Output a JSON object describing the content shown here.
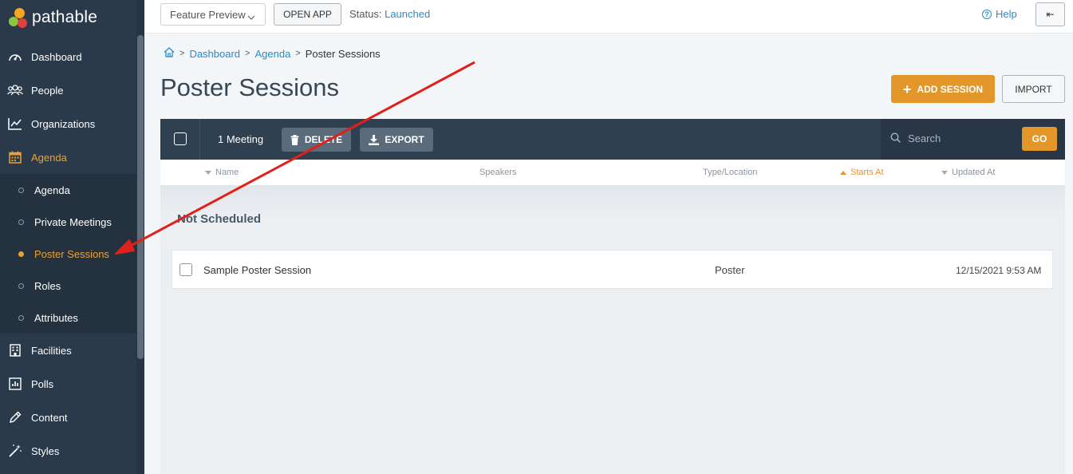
{
  "brand": {
    "name": "pathable"
  },
  "sidebar": {
    "items": [
      {
        "label": "Dashboard",
        "icon": "gauge-icon"
      },
      {
        "label": "People",
        "icon": "people-icon"
      },
      {
        "label": "Organizations",
        "icon": "chart-line-icon"
      },
      {
        "label": "Agenda",
        "icon": "calendar-icon",
        "active": true
      },
      {
        "label": "Facilities",
        "icon": "building-icon"
      },
      {
        "label": "Polls",
        "icon": "bar-chart-icon"
      },
      {
        "label": "Content",
        "icon": "pencil-icon"
      },
      {
        "label": "Styles",
        "icon": "magic-wand-icon"
      }
    ],
    "agenda_sub": [
      {
        "label": "Agenda"
      },
      {
        "label": "Private Meetings"
      },
      {
        "label": "Poster Sessions",
        "active": true
      },
      {
        "label": "Roles"
      },
      {
        "label": "Attributes"
      }
    ]
  },
  "topbar": {
    "feature_preview": "Feature Preview",
    "open_app": "OPEN APP",
    "status_label": "Status:",
    "status_value": "Launched",
    "help": "Help",
    "collapse": "⇤"
  },
  "breadcrumb": {
    "items": [
      "Dashboard",
      "Agenda",
      "Poster Sessions"
    ]
  },
  "page": {
    "title": "Poster Sessions",
    "add_session": "ADD SESSION",
    "import": "IMPORT"
  },
  "toolbar": {
    "count": "1 Meeting",
    "delete": "DELETE",
    "export": "EXPORT",
    "search_placeholder": "Search",
    "go": "GO"
  },
  "table": {
    "columns": [
      "Name",
      "Speakers",
      "Type/Location",
      "Starts At",
      "Updated At"
    ],
    "groups": [
      {
        "title": "Not Scheduled",
        "rows": [
          {
            "name": "Sample Poster Session",
            "speakers": "",
            "type": "Poster",
            "starts_at": "",
            "updated_at": "12/15/2021 9:53 AM"
          }
        ]
      }
    ]
  },
  "colors": {
    "sidebar_bg": "#2b3a4b",
    "accent": "#e3962a",
    "link": "#2a8bc9",
    "annotation_arrow": "#e0201b"
  }
}
